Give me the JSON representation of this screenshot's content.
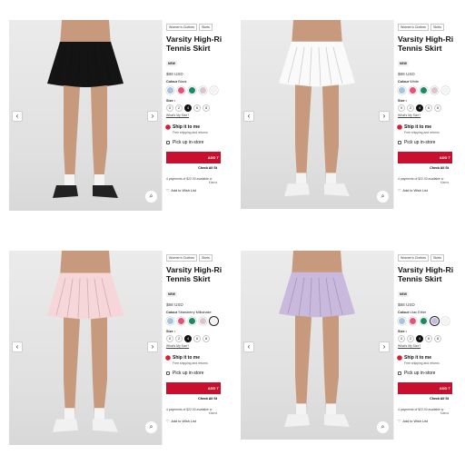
{
  "panels": [
    {
      "breadcrumbs": [
        "Women's Clothes",
        "Skirts"
      ],
      "title_line1": "Varsity High-Ri",
      "title_line2": "Tennis Skirt",
      "badge": "NEW",
      "price": "$88 USD",
      "colour_label": "Colour",
      "colour_name": "Black",
      "size_label": "Size",
      "sizes": [
        "0",
        "2",
        "4",
        "6",
        "8"
      ],
      "selected_size": "4",
      "size_guide": "What's My Size?",
      "ship_title": "Ship it to me",
      "ship_sub": "Free shipping and returns",
      "pickup": "Pick up in-store",
      "add_button": "ADD T",
      "check_all": "Check All St",
      "payments": "4 payments of $22.00 available w",
      "note": "Klarna",
      "wish": "Add to Wish List",
      "skirt_color": "#141414",
      "swatches": [
        "#a9c4e0",
        "#e8527a",
        "#1a8a66",
        "#d9c4cf",
        "#f3f3f3"
      ],
      "selected_swatch": -1
    },
    {
      "breadcrumbs": [
        "Women's Clothes",
        "Skirts"
      ],
      "title_line1": "Varsity High-Ri",
      "title_line2": "Tennis Skirt",
      "badge": "NEW",
      "price": "$88 USD",
      "colour_label": "Colour",
      "colour_name": "White",
      "size_label": "Size",
      "sizes": [
        "0",
        "2",
        "4",
        "6",
        "8"
      ],
      "selected_size": "4",
      "size_guide": "What's My Size?",
      "ship_title": "Ship it to me",
      "ship_sub": "Free shipping and returns",
      "pickup": "Pick up in-store",
      "add_button": "ADD T",
      "check_all": "Check All St",
      "payments": "4 payments of $22.00 available w",
      "note": "Klarna",
      "wish": "Add to Wish List",
      "skirt_color": "#fafafa",
      "swatches": [
        "#a9c4e0",
        "#e8527a",
        "#1a8a66",
        "#d9c4cf",
        "#f3f3f3"
      ],
      "selected_swatch": -1
    },
    {
      "breadcrumbs": [
        "Women's Clothes",
        "Skirts"
      ],
      "title_line1": "Varsity High-Ri",
      "title_line2": "Tennis Skirt",
      "badge": "NEW",
      "price": "$88 USD",
      "colour_label": "Colour",
      "colour_name": "Strawberry Milkshake",
      "size_label": "Size",
      "sizes": [
        "0",
        "2",
        "4",
        "6",
        "8"
      ],
      "selected_size": "4",
      "size_guide": "What's My Size?",
      "ship_title": "Ship it to me",
      "ship_sub": "Free shipping and returns",
      "pickup": "Pick up in-store",
      "add_button": "ADD T",
      "check_all": "Check All St",
      "payments": "4 payments of $22.00 available w",
      "note": "Klarna",
      "wish": "Add to Wish List",
      "skirt_color": "#f6d6d8",
      "swatches": [
        "#a9c4e0",
        "#e8527a",
        "#1a8a66",
        "#d9c4cf",
        "#f3f3f3"
      ],
      "selected_swatch": 4
    },
    {
      "breadcrumbs": [
        "Women's Clothes",
        "Skirts"
      ],
      "title_line1": "Varsity High-Ri",
      "title_line2": "Tennis Skirt",
      "badge": "NEW",
      "price": "$88 USD",
      "colour_label": "Colour",
      "colour_name": "Lilac Ether",
      "size_label": "Size",
      "sizes": [
        "0",
        "2",
        "4",
        "6",
        "8"
      ],
      "selected_size": "4",
      "size_guide": "What's My Size?",
      "ship_title": "Ship it to me",
      "ship_sub": "Free shipping and returns",
      "pickup": "Pick up in-store",
      "add_button": "ADD T",
      "check_all": "Check All St",
      "payments": "4 payments of $22.00 available w",
      "note": "Klarna",
      "wish": "Add to Wish List",
      "skirt_color": "#c9b9dc",
      "swatches": [
        "#a9c4e0",
        "#e8527a",
        "#1a8a66",
        "#c9b9dc",
        "#f3f3f3"
      ],
      "selected_swatch": 3
    }
  ],
  "icons": {
    "prev": "chevron-left-icon",
    "next": "chevron-right-icon",
    "zoom": "magnifier-icon",
    "wish": "heart-icon"
  }
}
